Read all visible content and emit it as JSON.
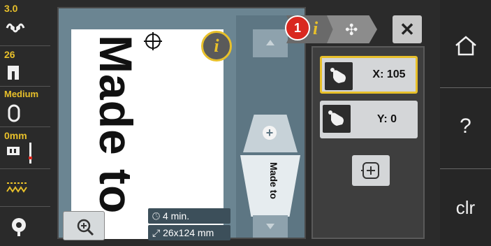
{
  "left_bar": {
    "tension_value": "3.0",
    "stitch_number": "26",
    "speed_label": "Medium",
    "needle_position": "0mm"
  },
  "design": {
    "text": "Made to",
    "mini_text": "Made to"
  },
  "info_bubble_glyph": "i",
  "status": {
    "time": "4 min.",
    "size": "26x124 mm"
  },
  "tabs": {
    "badge": "1",
    "info_glyph": "i",
    "move_glyph": "✣",
    "close": "✕"
  },
  "controls": {
    "x_label": "X: 105",
    "y_label": "Y: 0"
  },
  "right_bar": {
    "home_icon": "home-icon",
    "help_label": "?",
    "clr_label": "clr"
  },
  "colors": {
    "accent": "#e8c02a",
    "panel": "#6b8592",
    "badge": "#d9281f"
  }
}
